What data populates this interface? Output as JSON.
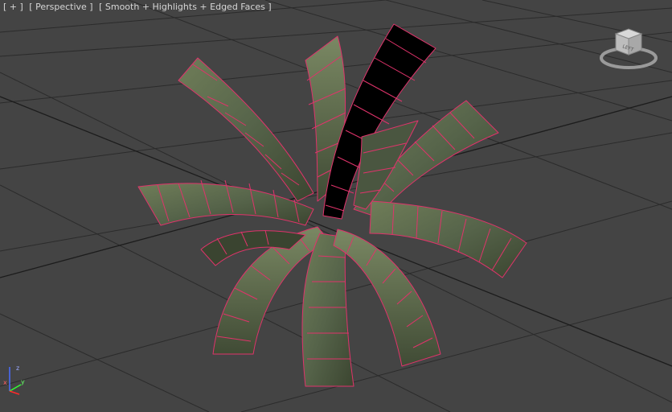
{
  "viewport": {
    "labels": {
      "menu": "[ + ]",
      "view": "[ Perspective ]",
      "shading": "[ Smooth + Highlights + Edged Faces ]"
    },
    "viewcube": {
      "face_label": "LEFT"
    },
    "axes": {
      "x": "x",
      "y": "y",
      "z": "z"
    }
  },
  "colors": {
    "background": "#444444",
    "grid": "#2a2a2a",
    "grid_major": "#1e1e1e",
    "leaf_fill": "#5d6b4b",
    "leaf_dark": "#3e4a33",
    "leaf_back": "#000000",
    "edges": "#e0336b",
    "axis_x": "#ff2a2a",
    "axis_y": "#33ff33",
    "axis_z": "#4a6cff"
  }
}
